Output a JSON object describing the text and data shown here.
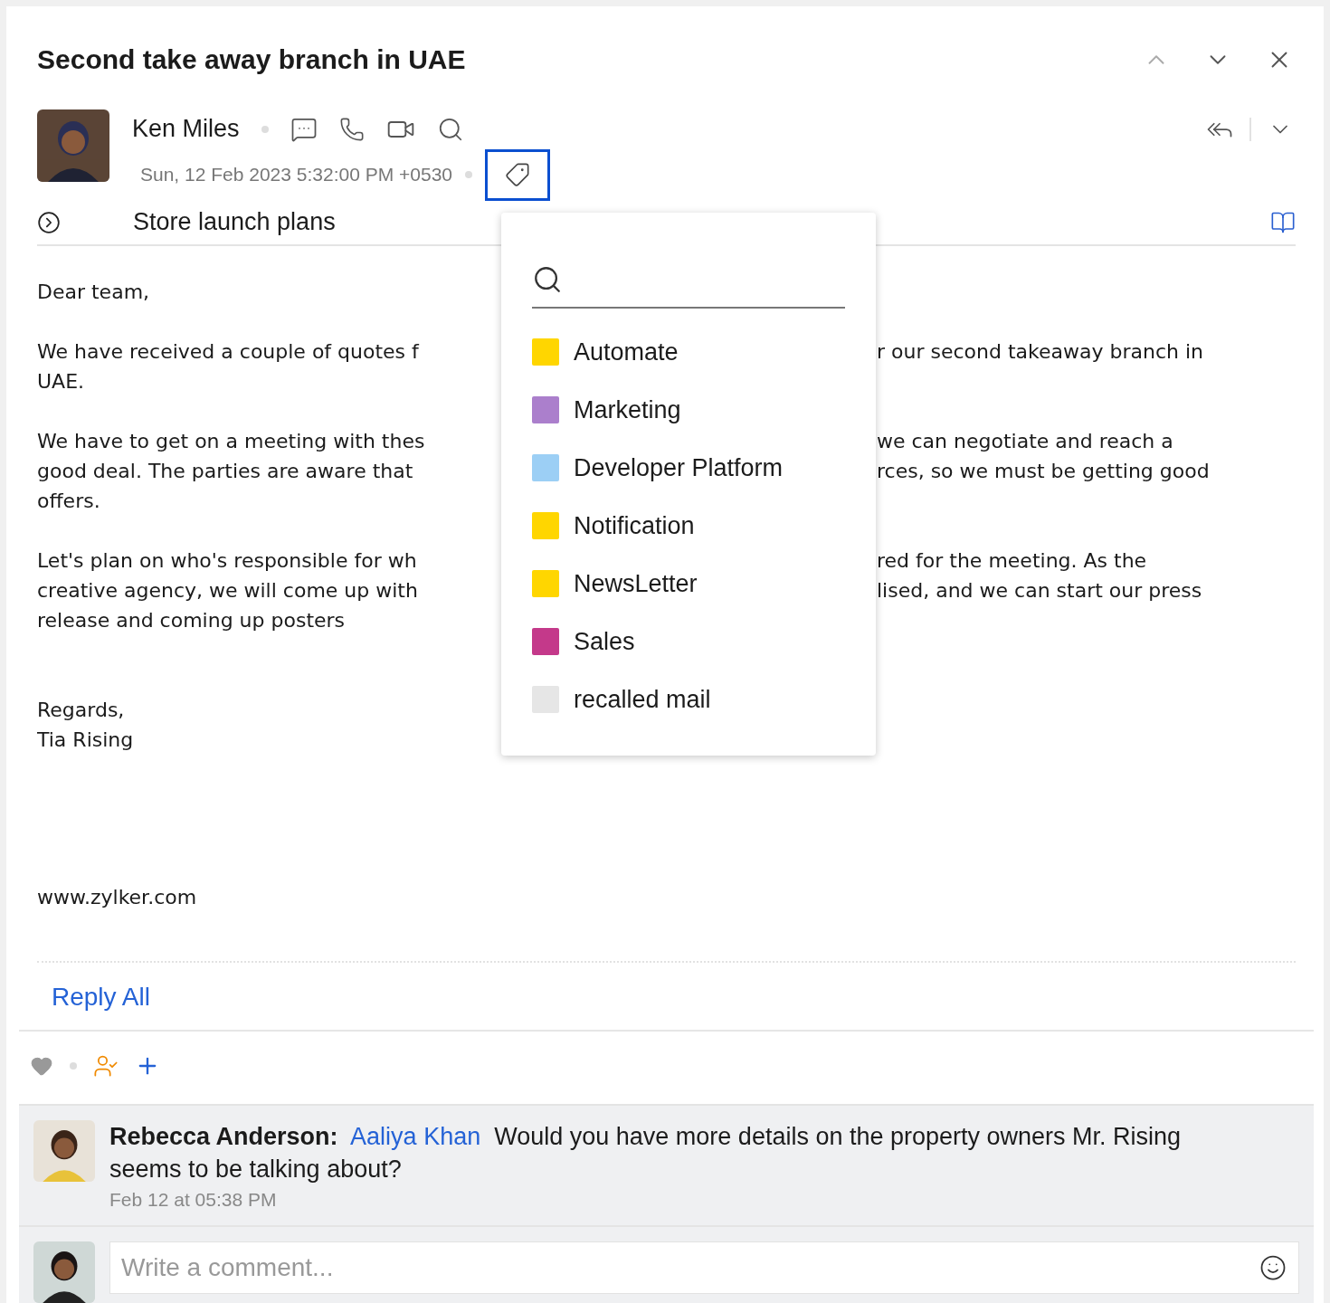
{
  "email": {
    "title": "Second take away branch in UAE",
    "sender": {
      "name": "Ken Miles",
      "date": "Sun, 12 Feb 2023 5:32:00 PM +0530"
    },
    "subject": "Store launch plans",
    "body": [
      {
        "lines": [
          {
            "left": "Dear team,"
          }
        ]
      },
      {
        "lines": [
          {
            "left": "We have received a couple of quotes f",
            "right": "r our second takeaway branch in"
          },
          {
            "left": "UAE."
          }
        ]
      },
      {
        "lines": [
          {
            "left": "We have to get on a meeting with thes",
            "right": "we can negotiate and reach a"
          },
          {
            "left": "good deal. The parties are aware that",
            "right": "rces, so we must be getting good"
          },
          {
            "left": "offers."
          }
        ]
      },
      {
        "lines": [
          {
            "left": "Let's plan on who's responsible for wh",
            "right": "red for the meeting. As the"
          },
          {
            "left": "creative agency, we will come up with",
            "right": "lised, and we can start our press"
          },
          {
            "left": "release and coming up posters"
          }
        ]
      },
      {
        "lines": [
          {
            "left": "Regards,"
          },
          {
            "left": "Tia Rising"
          }
        ]
      },
      {
        "lines": [
          {
            "left": "www.zylker.com"
          }
        ]
      }
    ],
    "reply_all": "Reply All"
  },
  "tag_popup": {
    "tags": [
      {
        "label": "Automate",
        "color": "#ffd600"
      },
      {
        "label": "Marketing",
        "color": "#ab7fcc"
      },
      {
        "label": "Developer Platform",
        "color": "#9ccff5"
      },
      {
        "label": "Notification",
        "color": "#ffd600"
      },
      {
        "label": "NewsLetter",
        "color": "#ffd600"
      },
      {
        "label": "Sales",
        "color": "#c4398a"
      },
      {
        "label": "recalled mail",
        "color": "#e6e6e6"
      }
    ]
  },
  "comments": [
    {
      "author": "Rebecca Anderson:",
      "mention": "Aaliya Khan",
      "text": "Would you have more details on the property owners Mr. Rising seems to be talking about?",
      "time": "Feb 12 at 05:38 PM"
    }
  ],
  "compose": {
    "placeholder": "Write a comment..."
  }
}
